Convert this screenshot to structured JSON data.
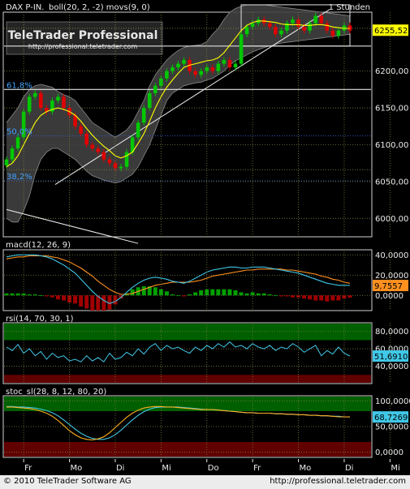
{
  "header": {
    "instrument": "DAX P-IN.",
    "indicators": "boll(20, 2, -2) movs(9, 0)",
    "timeframe": "1 Stunden"
  },
  "watermark": {
    "brand": "TeleTrader Professional",
    "url": "http://professional.teletrader.com"
  },
  "footer": {
    "copyright": "© 2010 TeleTrader Software AG",
    "url": "http://professional.teletrader.com"
  },
  "colors": {
    "background": "#000000",
    "panel_border": "#d0d0d0",
    "grid": "#7f7f3f",
    "bollinger_fill": "#404040",
    "bollinger_edge": "#8a8a8a",
    "moving_average": "#ffff00",
    "candle_up": "#00c800",
    "candle_down": "#e00000",
    "macd_line": "#40c8e8",
    "signal_line": "#ff9020",
    "hist_pos": "#00a000",
    "hist_neg": "#a00000",
    "rsi_line": "#40c8e8",
    "stoch_k": "#ffb020",
    "stoch_d": "#40c8e8",
    "zone_green": "#006000",
    "zone_red": "#600000",
    "fib_text": "#40a0ff",
    "price_box": "#ffff00",
    "macd_box": "#ff9020",
    "cyan_box": "#40c8e8"
  },
  "chart_data": [
    {
      "id": "price",
      "type": "candlestick",
      "title": "DAX P-IN.",
      "yticks": [
        6000,
        6050,
        6100,
        6150,
        6200
      ],
      "ytick_labels": [
        "6000,00",
        "6050,00",
        "6100,00",
        "6150,00",
        "6200,00"
      ],
      "ylim": [
        5975,
        6280
      ],
      "last_value": "6255,52",
      "fib_levels": [
        {
          "label": "61,8%",
          "value": 6175
        },
        {
          "label": "50,0%",
          "value": 6112
        },
        {
          "label": "38,2%",
          "value": 6051
        }
      ],
      "horizontal_lines": [
        6290,
        6258,
        6234,
        6175,
        6112,
        6066,
        6051
      ],
      "closes": [
        6080,
        6095,
        6110,
        6145,
        6165,
        6170,
        6150,
        6145,
        6160,
        6165,
        6150,
        6140,
        6125,
        6115,
        6100,
        6095,
        6090,
        6080,
        6075,
        6068,
        6070,
        6090,
        6110,
        6130,
        6150,
        6170,
        6180,
        6190,
        6200,
        6205,
        6210,
        6215,
        6200,
        6195,
        6200,
        6205,
        6200,
        6210,
        6215,
        6205,
        6210,
        6250,
        6260,
        6265,
        6270,
        6265,
        6260,
        6250,
        6255,
        6265,
        6270,
        6260,
        6255,
        6265,
        6275,
        6265,
        6255,
        6248,
        6255,
        6262,
        6255
      ],
      "bollinger": {
        "upper": [
          6130,
          6140,
          6150,
          6165,
          6175,
          6180,
          6182,
          6180,
          6178,
          6172,
          6168,
          6165,
          6160,
          6150,
          6140,
          6130,
          6125,
          6120,
          6115,
          6110,
          6115,
          6120,
          6130,
          6145,
          6160,
          6180,
          6195,
          6205,
          6215,
          6222,
          6228,
          6232,
          6234,
          6235,
          6236,
          6240,
          6250,
          6258,
          6270,
          6280,
          6285,
          6288,
          6290,
          6290,
          6290,
          6290,
          6289,
          6288,
          6287,
          6286,
          6285,
          6284,
          6283,
          6282,
          6281,
          6280,
          6279,
          6278,
          6277,
          6276,
          6275
        ],
        "lower": [
          6000,
          5995,
          5995,
          6010,
          6030,
          6060,
          6080,
          6090,
          6095,
          6095,
          6090,
          6085,
          6080,
          6072,
          6064,
          6058,
          6055,
          6052,
          6050,
          6048,
          6050,
          6055,
          6060,
          6070,
          6085,
          6100,
          6120,
          6140,
          6160,
          6170,
          6175,
          6180,
          6182,
          6184,
          6185,
          6188,
          6190,
          6195,
          6200,
          6208,
          6214,
          6218,
          6222,
          6226,
          6229,
          6232,
          6234,
          6236,
          6238,
          6239,
          6240,
          6241,
          6242,
          6243,
          6244,
          6245,
          6246,
          6247,
          6248,
          6249,
          6250
        ]
      },
      "moving_average": [
        6070,
        6075,
        6085,
        6100,
        6115,
        6130,
        6140,
        6145,
        6148,
        6150,
        6148,
        6145,
        6140,
        6132,
        6122,
        6113,
        6105,
        6098,
        6092,
        6085,
        6082,
        6085,
        6090,
        6102,
        6115,
        6132,
        6150,
        6165,
        6178,
        6188,
        6197,
        6205,
        6208,
        6210,
        6212,
        6214,
        6215,
        6218,
        6225,
        6235,
        6245,
        6255,
        6262,
        6266,
        6268,
        6268,
        6267,
        6266,
        6264,
        6263,
        6263,
        6263,
        6262,
        6262,
        6263,
        6263,
        6262,
        6260,
        6259,
        6258,
        6258
      ],
      "trendlines": [
        {
          "x1": 8.5,
          "y1": 6046,
          "x2": 56.5,
          "y2": 6284
        },
        {
          "x1": 0,
          "y1": 6012,
          "x2": 23,
          "y2": 5966
        }
      ]
    },
    {
      "id": "macd",
      "type": "line",
      "title": "macd(12, 26, 9)",
      "yticks": [
        0,
        20,
        40
      ],
      "ytick_labels": [
        "0,0000",
        "20,0000",
        "40,0000"
      ],
      "ylim": [
        -15,
        45
      ],
      "last_value": "9,7557",
      "macd": [
        38,
        39,
        40,
        40,
        40,
        40,
        39,
        38,
        36,
        33,
        30,
        26,
        22,
        16,
        10,
        4,
        -1,
        -5,
        -8,
        -6,
        -2,
        3,
        8,
        12,
        15,
        17,
        18,
        17,
        16,
        14,
        13,
        12,
        14,
        17,
        20,
        23,
        25,
        26,
        27,
        28,
        28,
        27,
        27,
        28,
        28,
        28,
        27,
        26,
        25,
        24,
        23,
        22,
        20,
        18,
        16,
        14,
        12,
        11,
        10,
        10,
        9.8
      ],
      "signal": [
        36,
        37,
        38,
        38,
        39,
        39,
        39,
        39,
        38,
        37,
        35,
        33,
        30,
        27,
        23,
        19,
        14,
        10,
        6,
        3,
        1,
        1,
        2,
        4,
        6,
        8,
        10,
        11,
        12,
        13,
        13,
        13,
        13,
        14,
        15,
        17,
        19,
        20,
        21,
        22,
        23,
        24,
        25,
        25,
        26,
        26,
        26,
        26,
        26,
        25,
        25,
        24,
        23,
        22,
        21,
        19,
        18,
        16,
        15,
        13,
        12
      ],
      "histogram": [
        2,
        2,
        2,
        2,
        1,
        1,
        0,
        -1,
        -2,
        -4,
        -5,
        -7,
        -8,
        -11,
        -13,
        -15,
        -15,
        -15,
        -14,
        -9,
        -3,
        2,
        6,
        8,
        9,
        9,
        8,
        6,
        4,
        1,
        0,
        -1,
        1,
        3,
        5,
        6,
        6,
        6,
        6,
        6,
        5,
        3,
        2,
        3,
        2,
        2,
        1,
        0,
        -1,
        -1,
        -2,
        -2,
        -3,
        -4,
        -5,
        -5,
        -6,
        -5,
        -5,
        -3,
        -2.2
      ]
    },
    {
      "id": "rsi",
      "type": "line",
      "title": "rsi(14, 70, 30, 1)",
      "yticks": [
        40,
        60,
        80
      ],
      "ytick_labels": [
        "40,0000",
        "60,0000",
        "80,0000"
      ],
      "ylim": [
        20,
        90
      ],
      "upper_zone": 70,
      "lower_zone": 30,
      "last_value": "51,6910",
      "values": [
        62,
        58,
        65,
        55,
        60,
        52,
        57,
        48,
        55,
        50,
        52,
        46,
        48,
        45,
        52,
        46,
        50,
        45,
        55,
        48,
        50,
        56,
        52,
        60,
        54,
        62,
        66,
        58,
        64,
        60,
        62,
        58,
        55,
        62,
        58,
        64,
        60,
        66,
        62,
        68,
        62,
        64,
        60,
        66,
        62,
        60,
        64,
        58,
        62,
        60,
        66,
        62,
        56,
        60,
        64,
        52,
        58,
        54,
        62,
        55,
        51.7
      ]
    },
    {
      "id": "stochastic",
      "type": "line",
      "title": "stoc_sl(28, 8, 12, 80, 20)",
      "yticks": [
        0,
        50,
        100
      ],
      "ytick_labels": [
        "0,0000",
        "50,0000",
        "100,0000"
      ],
      "ylim": [
        -10,
        110
      ],
      "upper_zone": 80,
      "lower_zone": 20,
      "last_value": "68,7269",
      "k": [
        88,
        88,
        87,
        86,
        85,
        83,
        80,
        76,
        70,
        62,
        52,
        42,
        34,
        28,
        25,
        24,
        26,
        30,
        38,
        48,
        58,
        68,
        76,
        82,
        86,
        88,
        89,
        89,
        88,
        88,
        87,
        86,
        85,
        84,
        83,
        83,
        83,
        82,
        81,
        80,
        79,
        78,
        77,
        77,
        76,
        76,
        76,
        75,
        75,
        74,
        74,
        73,
        73,
        72,
        72,
        71,
        71,
        70,
        69,
        69,
        68.7
      ],
      "d": [
        89,
        89,
        88,
        88,
        87,
        86,
        84,
        81,
        77,
        71,
        63,
        54,
        45,
        37,
        31,
        27,
        25,
        25,
        28,
        34,
        43,
        53,
        63,
        72,
        79,
        84,
        87,
        88,
        88,
        88,
        88,
        87,
        86,
        85,
        84,
        83,
        83,
        82,
        81,
        80,
        79,
        78,
        77,
        77,
        76,
        76,
        76,
        75,
        75,
        74,
        74,
        73,
        73,
        72,
        72,
        71,
        71,
        70,
        70,
        69,
        69
      ]
    }
  ],
  "xaxis": {
    "labels": [
      "Fr",
      "Mo",
      "Di",
      "Mi",
      "Do",
      "Fr",
      "Mo",
      "Di",
      "Mi",
      "Do"
    ],
    "positions": [
      3,
      11,
      19,
      27,
      35,
      43,
      51,
      59,
      67,
      75
    ]
  }
}
